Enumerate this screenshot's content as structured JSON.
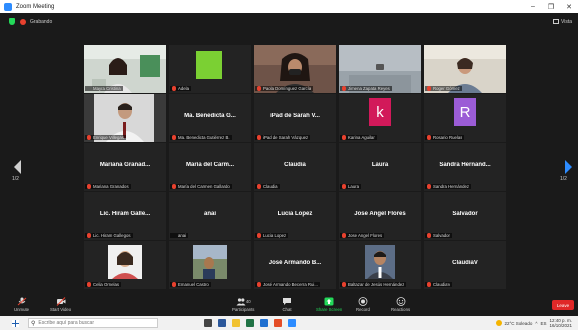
{
  "window": {
    "title": "Zoom Meeting",
    "controls": [
      "–",
      "❐",
      "✕"
    ]
  },
  "topbar": {
    "recording_label": "Grabando",
    "view_label": "Vista"
  },
  "nav": {
    "left_page": "1/2",
    "right_page": "1/2"
  },
  "tiles": [
    {
      "name": "Mayra Cristina",
      "type": "video"
    },
    {
      "name": "Adela",
      "type": "green"
    },
    {
      "name": "Paola Domínguez García",
      "type": "video"
    },
    {
      "name": "Jimena Zapata Reyes",
      "type": "video"
    },
    {
      "name": "Roger Gómez",
      "type": "video"
    },
    {
      "name": "Enrique Villegas",
      "type": "video"
    },
    {
      "name": "Ma. Benedicta Gutiérrez B.",
      "center": "Ma. Benedicta G...",
      "type": "name"
    },
    {
      "name": "iPad de Sarah Vázquez",
      "center": "iPad de Sarah V...",
      "type": "name"
    },
    {
      "name": "Karina Aguilar",
      "type": "letter",
      "letter": "k",
      "color": "#d2195a"
    },
    {
      "name": "Rosario Ruelas",
      "type": "letter",
      "letter": "R",
      "color": "#9b5cd6"
    },
    {
      "name": "Mariana Granados",
      "center": "Mariana Granad...",
      "type": "name"
    },
    {
      "name": "María del Carmen Gallardo",
      "center": "María del Carm...",
      "type": "name"
    },
    {
      "name": "Claudia",
      "center": "Claudia",
      "type": "name"
    },
    {
      "name": "Laura",
      "center": "Laura",
      "type": "name"
    },
    {
      "name": "Sandra Hernández",
      "center": "Sandra Hernand...",
      "type": "name"
    },
    {
      "name": "Lic. Hiram Gallegos",
      "center": "Lic. Hiram Galle...",
      "type": "name"
    },
    {
      "name": "anai",
      "center": "anai",
      "type": "name"
    },
    {
      "name": "Lucia Lopez",
      "center": "Lucia Lopez",
      "type": "name"
    },
    {
      "name": "Jose Angel Flores",
      "center": "Jose Angel Flores",
      "type": "name"
    },
    {
      "name": "Salvador",
      "center": "Salvador",
      "type": "name"
    },
    {
      "name": "Celia Ornelas",
      "type": "video"
    },
    {
      "name": "Emanuel Castro",
      "type": "video"
    },
    {
      "name": "José Armando Becerra Rui...",
      "center": "José Armando B...",
      "type": "name"
    },
    {
      "name": "Baltazar de Jesús Hernández",
      "type": "video"
    },
    {
      "name": "ClaudiaV",
      "center": "ClaudiaV",
      "type": "name"
    }
  ],
  "toolbar": {
    "mute": "Unmute",
    "video": "Start Video",
    "participants": "Participants",
    "participants_count": "40",
    "chat": "Chat",
    "share": "Share Screen",
    "record": "Record",
    "reactions": "Reactions",
    "leave": "Leave"
  },
  "taskbar": {
    "search_placeholder": "Escribe aquí para buscar",
    "weather": "22°C Soleado",
    "language": "ES",
    "time": "12:40 p. m.",
    "date": "16/10/2021"
  }
}
